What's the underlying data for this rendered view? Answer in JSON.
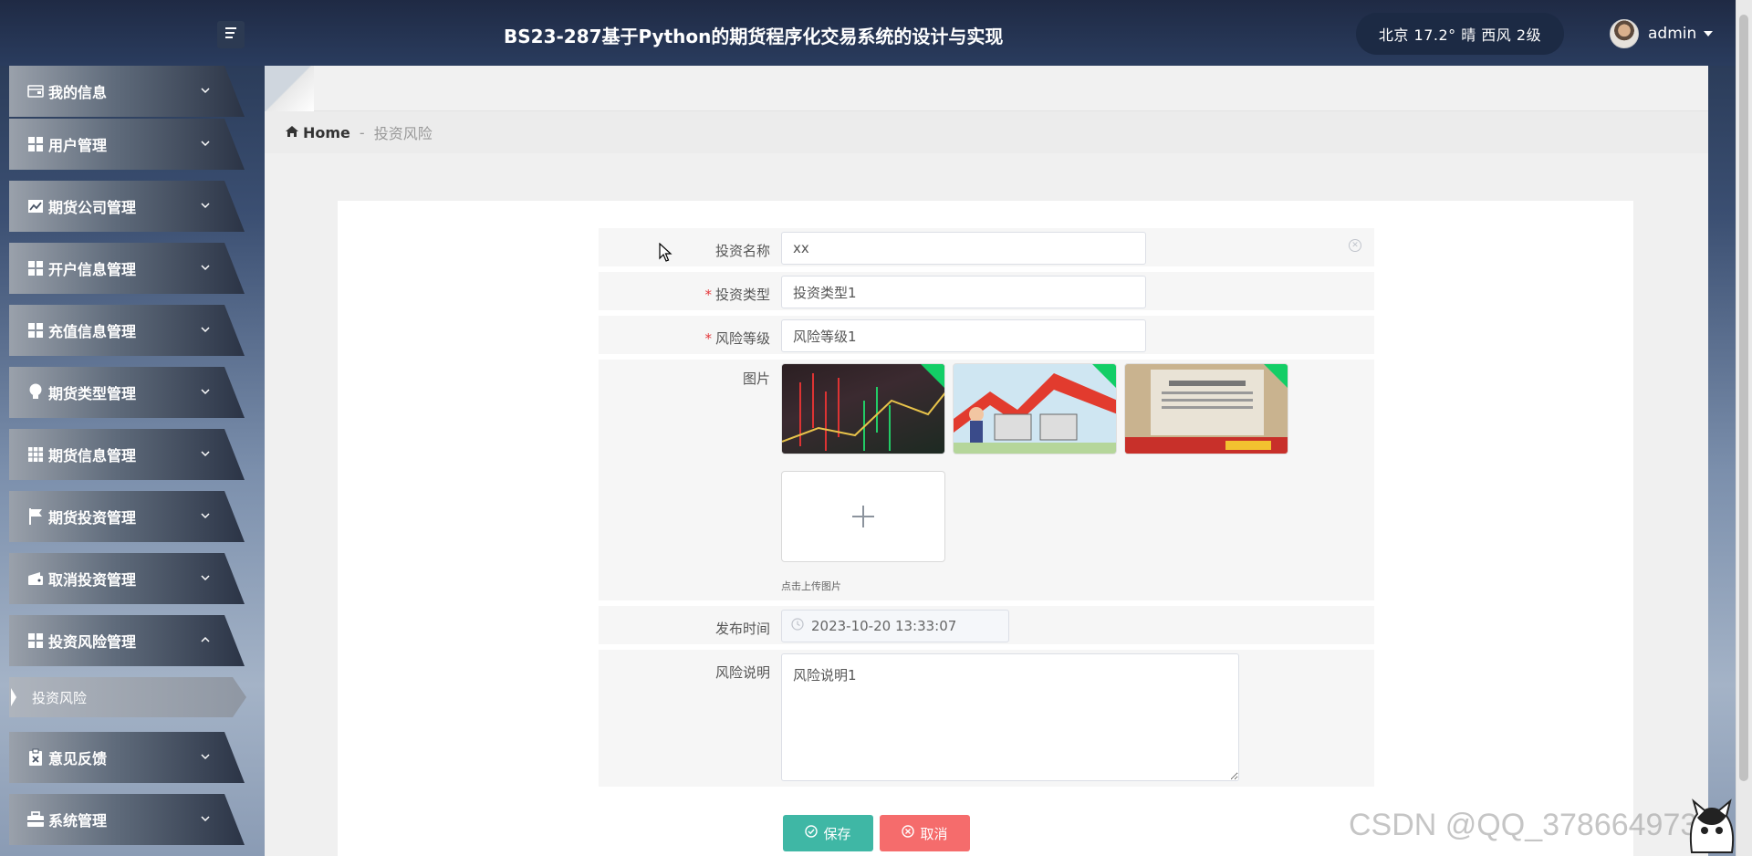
{
  "header": {
    "app_title": "BS23-287基于Python的期货程序化交易系统的设计与实现",
    "weather": "北京  17.2°  晴  西风  2级",
    "username": "admin"
  },
  "sidebar": {
    "items": [
      {
        "label": "我的信息",
        "icon": "wallet-icon",
        "expanded": false
      },
      {
        "label": "用户管理",
        "icon": "grid-icon",
        "expanded": false
      },
      {
        "label": "期货公司管理",
        "icon": "chart-icon",
        "expanded": false
      },
      {
        "label": "开户信息管理",
        "icon": "grid-icon",
        "expanded": false
      },
      {
        "label": "充值信息管理",
        "icon": "grid-icon",
        "expanded": false
      },
      {
        "label": "期货类型管理",
        "icon": "bulb-icon",
        "expanded": false
      },
      {
        "label": "期货信息管理",
        "icon": "table-icon",
        "expanded": false
      },
      {
        "label": "期货投资管理",
        "icon": "flag-icon",
        "expanded": false
      },
      {
        "label": "取消投资管理",
        "icon": "wallet-icon",
        "expanded": false
      },
      {
        "label": "投资风险管理",
        "icon": "grid-icon",
        "expanded": true
      },
      {
        "label": "意见反馈",
        "icon": "clipboard-icon",
        "expanded": false
      },
      {
        "label": "系统管理",
        "icon": "briefcase-icon",
        "expanded": false
      }
    ],
    "subitem": "投资风险"
  },
  "breadcrumb": {
    "home": "Home",
    "separator": "-",
    "current": "投资风险"
  },
  "form": {
    "name_label": "投资名称",
    "name_value": "xx",
    "type_label": "投资类型",
    "type_value": "投资类型1",
    "risk_label": "风险等级",
    "risk_value": "风险等级1",
    "image_label": "图片",
    "upload_tip": "点击上传图片",
    "image_count": 3,
    "time_label": "发布时间",
    "time_value": "2023-10-20 13:33:07",
    "desc_label": "风险说明",
    "desc_value": "风险说明1",
    "required_mark": "*"
  },
  "buttons": {
    "save": "保存",
    "cancel": "取消"
  },
  "watermark": "CSDN @QQ_3786649731",
  "colors": {
    "save": "#3fb7a5",
    "cancel": "#f56c6c",
    "upload_ok": "#13ce66"
  }
}
